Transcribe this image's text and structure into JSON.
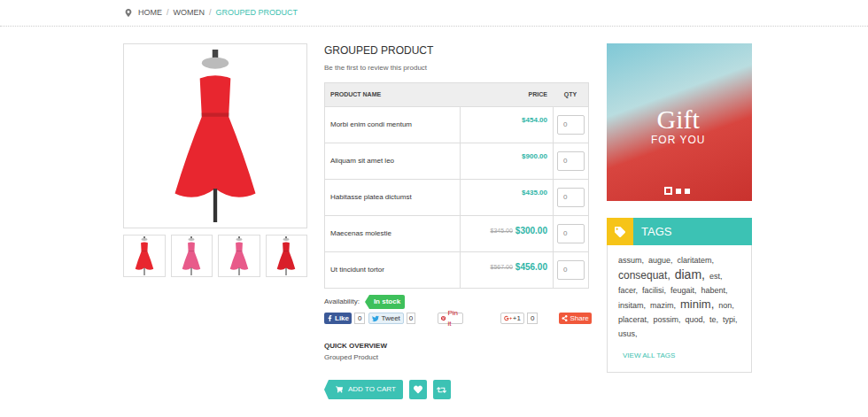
{
  "breadcrumb": {
    "separator": "/",
    "items": [
      {
        "label": "HOME",
        "selected": false
      },
      {
        "label": "WOMEN",
        "selected": false
      },
      {
        "label": "GROUPED PRODUCT",
        "selected": true
      }
    ]
  },
  "gallery": {
    "main_color": "#e8262f",
    "thumbnails": [
      {
        "color": "#e8262f"
      },
      {
        "color": "#e85a8a"
      },
      {
        "color": "#e85a8a"
      },
      {
        "color": "#d91f2a"
      }
    ]
  },
  "product": {
    "title": "GROUPED PRODUCT",
    "review_text": "Be the first to review this product",
    "table": {
      "columns": [
        "PRODUCT NAME",
        "PRICE",
        "QTY"
      ],
      "rows": [
        {
          "name": "Morbi enim condi mentum",
          "old_price": "",
          "price": "$454.00",
          "qty": "0"
        },
        {
          "name": "Aliquam sit amet leo",
          "old_price": "",
          "price": "$900.00",
          "qty": "0"
        },
        {
          "name": "Habitasse platea dictumst",
          "old_price": "",
          "price": "$435.00",
          "qty": "0"
        },
        {
          "name": "Maecenas molestie",
          "old_price": "$345.00",
          "price": "$300.00",
          "qty": "0"
        },
        {
          "name": "Ut tincidunt tortor",
          "old_price": "$567.00",
          "price": "$456.00",
          "qty": "0"
        }
      ]
    },
    "availability": {
      "label": "Availability:",
      "status": "In stock"
    },
    "social": [
      {
        "kind": "facebook",
        "label": "Like",
        "count": "0"
      },
      {
        "kind": "twitter",
        "label": "Tweet",
        "count": "0"
      },
      {
        "kind": "pinterest",
        "label": "Pin it",
        "count": ""
      },
      {
        "kind": "google",
        "label": "+1",
        "count": "0"
      },
      {
        "kind": "share",
        "label": "Share",
        "count": ""
      }
    ],
    "quick_overview": {
      "title": "QUICK OVERVIEW",
      "text": "Grouped Product"
    },
    "add_to_cart": "ADD TO CART"
  },
  "banner": {
    "title": "Gift",
    "subtitle": "FOR YOU",
    "slides": [
      {
        "selected": true
      },
      {
        "selected": false
      },
      {
        "selected": false
      }
    ]
  },
  "tags": {
    "title": "TAGS",
    "view_all": "VIEW ALL TAGS",
    "items": [
      {
        "label": "assum,",
        "level": 0.2
      },
      {
        "label": "augue,",
        "level": 0.2
      },
      {
        "label": "claritatem,",
        "level": 0.2
      },
      {
        "label": "consequat,",
        "level": 0.6
      },
      {
        "label": "diam,",
        "level": 1
      },
      {
        "label": "est,",
        "level": 0.2
      },
      {
        "label": "facer,",
        "level": 0.2
      },
      {
        "label": "facilisi,",
        "level": 0.2
      },
      {
        "label": "feugait,",
        "level": 0.2
      },
      {
        "label": "habent,",
        "level": 0.2
      },
      {
        "label": "insitam,",
        "level": 0.2
      },
      {
        "label": "mazim,",
        "level": 0.2
      },
      {
        "label": "minim,",
        "level": 0.8
      },
      {
        "label": "non,",
        "level": 0.2
      },
      {
        "label": "placerat,",
        "level": 0.2
      },
      {
        "label": "possim,",
        "level": 0.2
      },
      {
        "label": "quod,",
        "level": 0.2
      },
      {
        "label": "te,",
        "level": 0.2
      },
      {
        "label": "typi,",
        "level": 0.2
      },
      {
        "label": "usus,",
        "level": 0.2
      }
    ]
  }
}
